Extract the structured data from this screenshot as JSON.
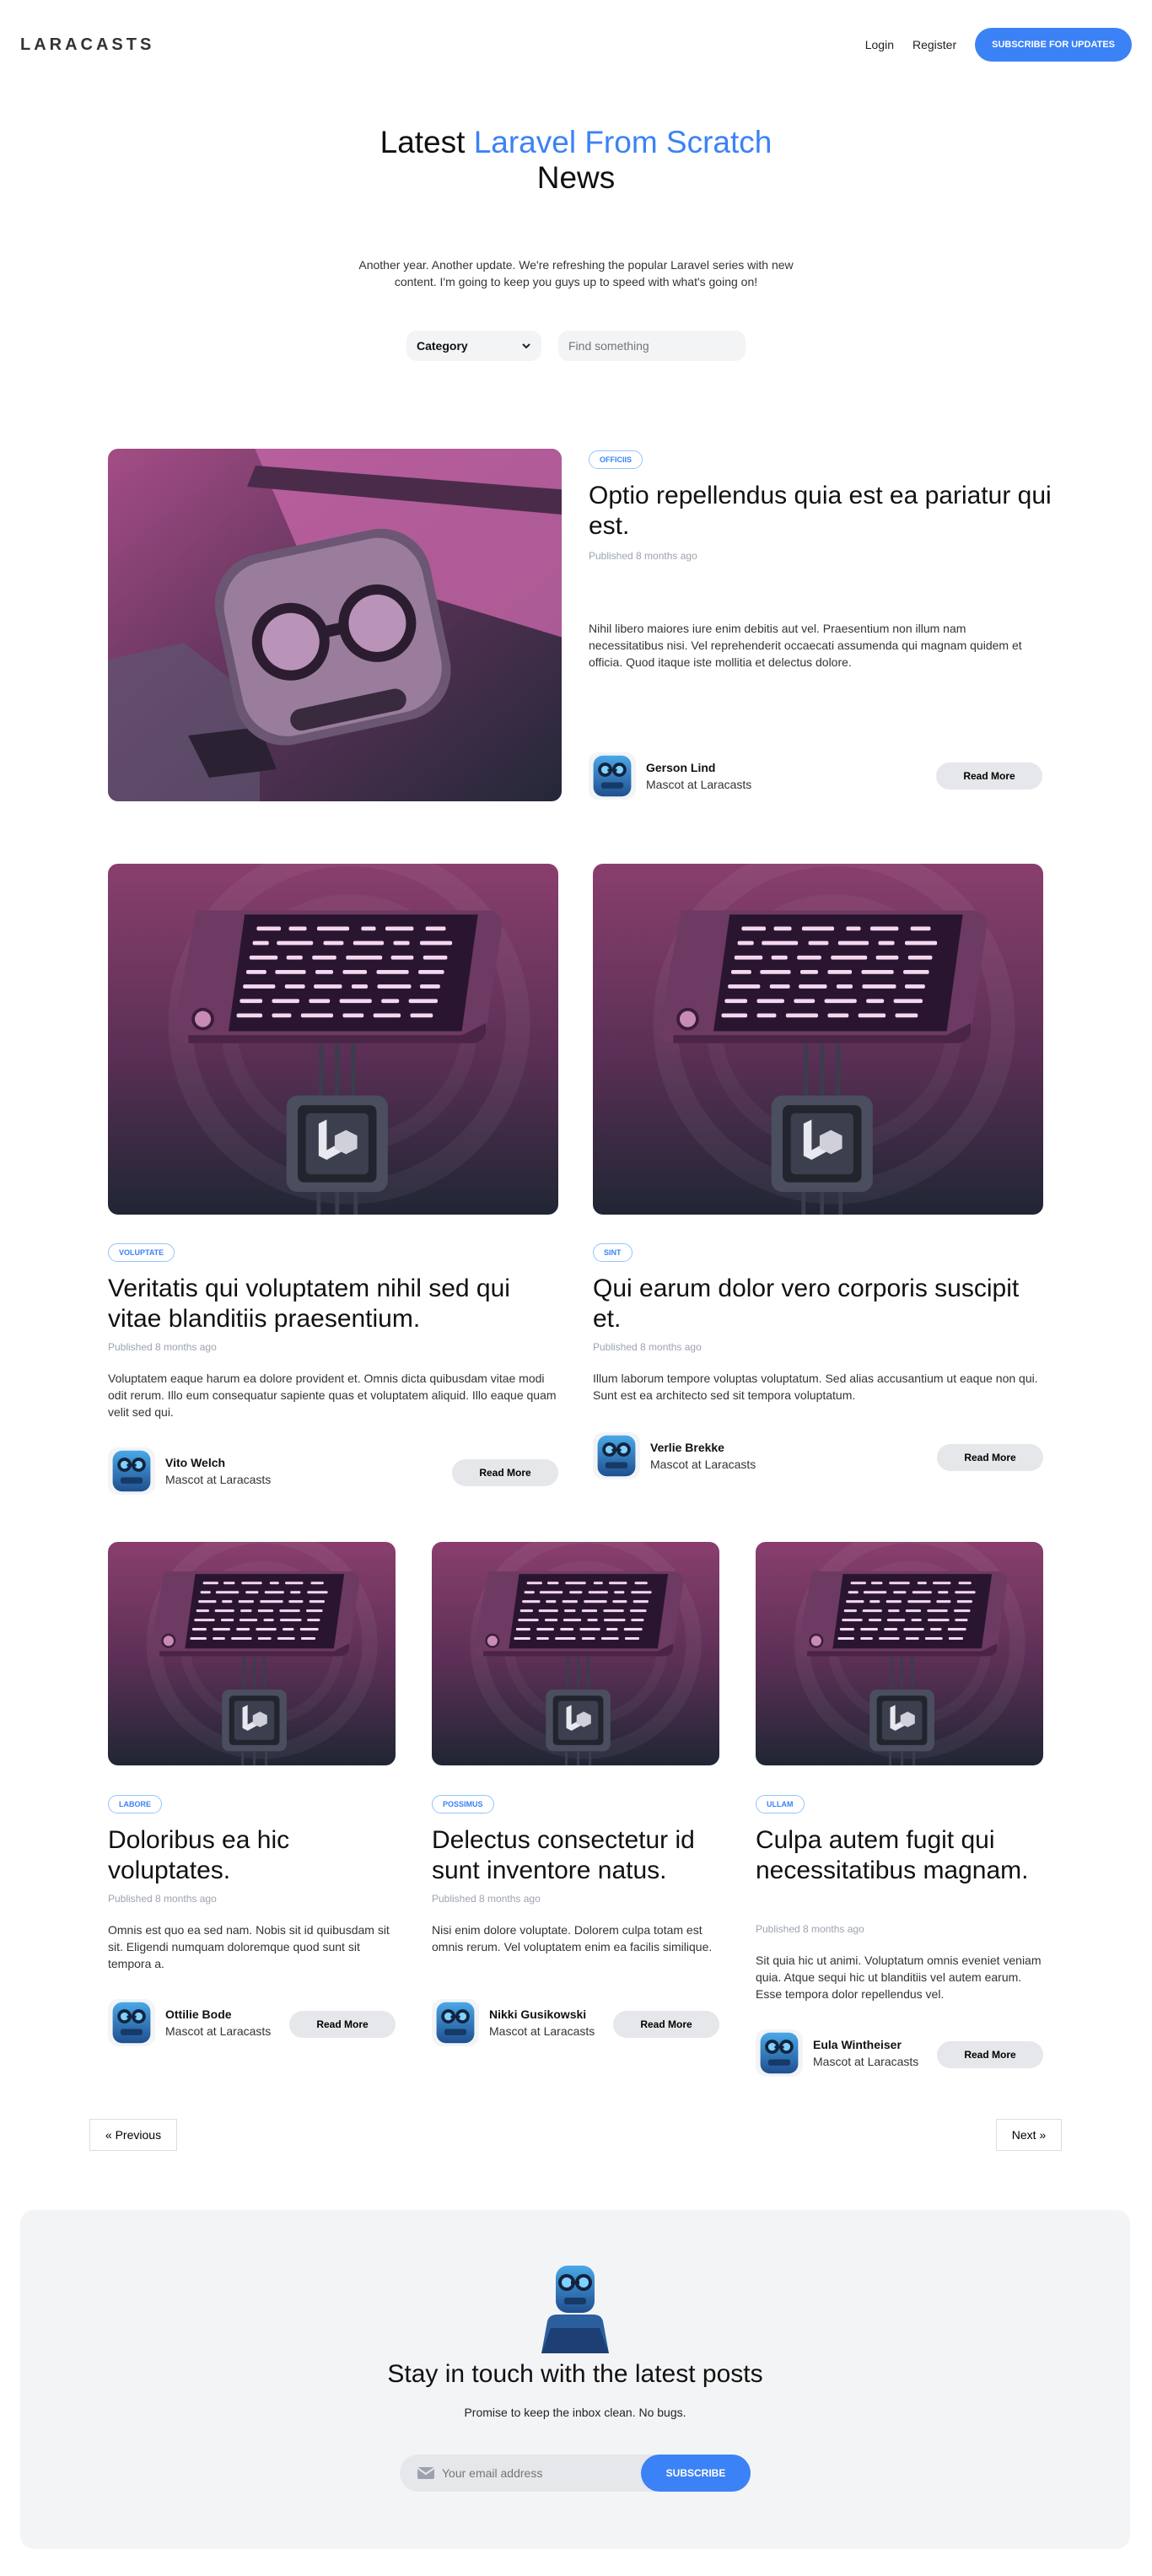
{
  "nav": {
    "logo_text": "LARACASTS",
    "login": "Login",
    "register": "Register",
    "subscribe": "SUBSCRIBE FOR UPDATES"
  },
  "hero": {
    "title_pre": "Latest ",
    "title_highlight": "Laravel From Scratch",
    "title_post": "News",
    "intro": "Another year. Another update. We're refreshing the popular Laravel series with new content. I'm going to keep you guys up to speed with what's going on!"
  },
  "filters": {
    "category": "Category",
    "search_placeholder": "Find something"
  },
  "posts": [
    {
      "category": "Officiis",
      "title": "Optio repellendus quia est ea pariatur qui est.",
      "published": "Published 8 months ago",
      "excerpt": "Nihil libero maiores iure enim debitis aut vel. Praesentium non illum nam necessitatibus nisi. Vel reprehenderit occaecati assumenda qui magnam quidem et officia. Quod itaque iste mollitia et delectus dolore.",
      "author": "Gerson Lind",
      "role": "Mascot at Laracasts",
      "read_more": "Read More"
    },
    {
      "category": "Voluptate",
      "title": "Veritatis qui voluptatem nihil sed qui vitae blanditiis praesentium.",
      "published": "Published 8 months ago",
      "excerpt": "Voluptatem eaque harum ea dolore provident et. Omnis dicta quibusdam vitae modi odit rerum. Illo eum consequatur sapiente quas et voluptatem aliquid. Illo eaque quam velit sed qui.",
      "author": "Vito Welch",
      "role": "Mascot at Laracasts",
      "read_more": "Read More"
    },
    {
      "category": "Sint",
      "title": "Qui earum dolor vero corporis suscipit et.",
      "published": "Published 8 months ago",
      "excerpt": "Illum laborum tempore voluptas voluptatum. Sed alias accusantium ut eaque non qui. Sunt est ea architecto sed sit tempora voluptatum.",
      "author": "Verlie Brekke",
      "role": "Mascot at Laracasts",
      "read_more": "Read More"
    },
    {
      "category": "Labore",
      "title": "Doloribus ea hic voluptates.",
      "published": "Published 8 months ago",
      "excerpt": "Omnis est quo ea sed nam. Nobis sit id quibusdam sit sit. Eligendi numquam doloremque quod sunt sit tempora a.",
      "author": "Ottilie Bode",
      "role": "Mascot at Laracasts",
      "read_more": "Read More"
    },
    {
      "category": "Possimus",
      "title": "Delectus consectetur id sunt inventore natus.",
      "published": "Published 8 months ago",
      "excerpt": "Nisi enim dolore voluptate. Dolorem culpa totam est omnis rerum. Vel voluptatem enim ea facilis similique.",
      "author": "Nikki Gusikowski",
      "role": "Mascot at Laracasts",
      "read_more": "Read More"
    },
    {
      "category": "Ullam",
      "title": "Culpa autem fugit qui necessitatibus magnam.",
      "published": "Published 8 months ago",
      "excerpt": "Sit quia hic ut animi. Voluptatum omnis eveniet veniam quia. Atque sequi hic ut blanditiis vel autem earum. Esse tempora dolor repellendus vel.",
      "author": "Eula Wintheiser",
      "role": "Mascot at Laracasts",
      "read_more": "Read More"
    }
  ],
  "pagination": {
    "prev": "« Previous",
    "next": "Next »"
  },
  "newsletter": {
    "heading": "Stay in touch with the latest posts",
    "subheading": "Promise to keep the inbox clean. No bugs.",
    "email_placeholder": "Your email address",
    "button": "SUBSCRIBE"
  },
  "colors": {
    "accent": "#3b82f6",
    "card_top": "#7b3a63",
    "card_bottom": "#1f2937"
  }
}
